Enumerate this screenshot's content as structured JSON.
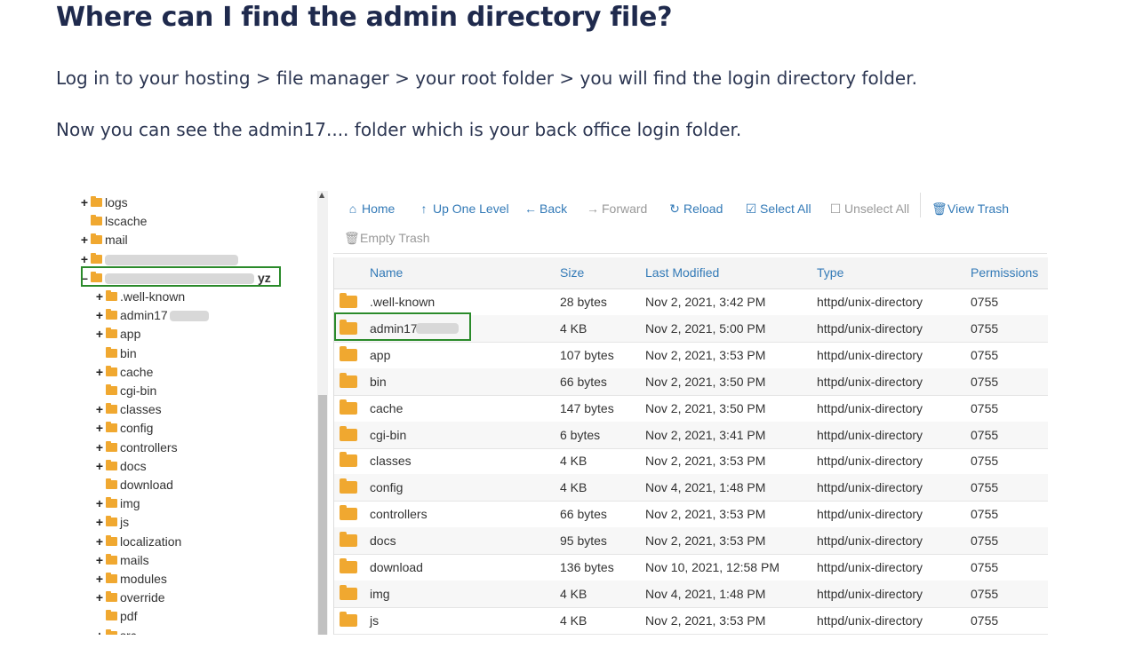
{
  "heading": "Where can I find the admin directory file?",
  "paragraphs": [
    "Log in to your hosting > file manager > your root folder > you will find the login directory folder.",
    "Now you can see the admin17.... folder which is your back office login folder."
  ],
  "tree": {
    "items": [
      {
        "toggle": "+",
        "label": "logs"
      },
      {
        "toggle": "",
        "label": "lscache"
      },
      {
        "toggle": "+",
        "label": "mail"
      },
      {
        "toggle": "+",
        "label": ""
      },
      {
        "toggle": "–",
        "label": "yz"
      },
      {
        "toggle": "+",
        "label": ".well-known"
      },
      {
        "toggle": "+",
        "label": "admin17"
      },
      {
        "toggle": "+",
        "label": "app"
      },
      {
        "toggle": "",
        "label": "bin"
      },
      {
        "toggle": "+",
        "label": "cache"
      },
      {
        "toggle": "",
        "label": "cgi-bin"
      },
      {
        "toggle": "+",
        "label": "classes"
      },
      {
        "toggle": "+",
        "label": "config"
      },
      {
        "toggle": "+",
        "label": "controllers"
      },
      {
        "toggle": "+",
        "label": "docs"
      },
      {
        "toggle": "",
        "label": "download"
      },
      {
        "toggle": "+",
        "label": "img"
      },
      {
        "toggle": "+",
        "label": "js"
      },
      {
        "toggle": "+",
        "label": "localization"
      },
      {
        "toggle": "+",
        "label": "mails"
      },
      {
        "toggle": "+",
        "label": "modules"
      },
      {
        "toggle": "+",
        "label": "override"
      },
      {
        "toggle": "",
        "label": "pdf"
      },
      {
        "toggle": "+",
        "label": "src"
      }
    ]
  },
  "toolbar": {
    "home": "Home",
    "up_one_level": "Up One Level",
    "back": "Back",
    "forward": "Forward",
    "reload": "Reload",
    "select_all": "Select All",
    "unselect_all": "Unselect All",
    "view_trash": "View Trash",
    "empty_trash": "Empty Trash"
  },
  "table": {
    "columns": [
      "Name",
      "Size",
      "Last Modified",
      "Type",
      "Permissions"
    ],
    "rows": [
      {
        "name": ".well-known",
        "size": "28 bytes",
        "modified": "Nov 2, 2021, 3:42 PM",
        "type": "httpd/unix-directory",
        "perm": "0755"
      },
      {
        "name": "admin17",
        "size": "4 KB",
        "modified": "Nov 2, 2021, 5:00 PM",
        "type": "httpd/unix-directory",
        "perm": "0755"
      },
      {
        "name": "app",
        "size": "107 bytes",
        "modified": "Nov 2, 2021, 3:53 PM",
        "type": "httpd/unix-directory",
        "perm": "0755"
      },
      {
        "name": "bin",
        "size": "66 bytes",
        "modified": "Nov 2, 2021, 3:50 PM",
        "type": "httpd/unix-directory",
        "perm": "0755"
      },
      {
        "name": "cache",
        "size": "147 bytes",
        "modified": "Nov 2, 2021, 3:50 PM",
        "type": "httpd/unix-directory",
        "perm": "0755"
      },
      {
        "name": "cgi-bin",
        "size": "6 bytes",
        "modified": "Nov 2, 2021, 3:41 PM",
        "type": "httpd/unix-directory",
        "perm": "0755"
      },
      {
        "name": "classes",
        "size": "4 KB",
        "modified": "Nov 2, 2021, 3:53 PM",
        "type": "httpd/unix-directory",
        "perm": "0755"
      },
      {
        "name": "config",
        "size": "4 KB",
        "modified": "Nov 4, 2021, 1:48 PM",
        "type": "httpd/unix-directory",
        "perm": "0755"
      },
      {
        "name": "controllers",
        "size": "66 bytes",
        "modified": "Nov 2, 2021, 3:53 PM",
        "type": "httpd/unix-directory",
        "perm": "0755"
      },
      {
        "name": "docs",
        "size": "95 bytes",
        "modified": "Nov 2, 2021, 3:53 PM",
        "type": "httpd/unix-directory",
        "perm": "0755"
      },
      {
        "name": "download",
        "size": "136 bytes",
        "modified": "Nov 10, 2021, 12:58 PM",
        "type": "httpd/unix-directory",
        "perm": "0755"
      },
      {
        "name": "img",
        "size": "4 KB",
        "modified": "Nov 4, 2021, 1:48 PM",
        "type": "httpd/unix-directory",
        "perm": "0755"
      },
      {
        "name": "js",
        "size": "4 KB",
        "modified": "Nov 2, 2021, 3:53 PM",
        "type": "httpd/unix-directory",
        "perm": "0755"
      }
    ]
  }
}
